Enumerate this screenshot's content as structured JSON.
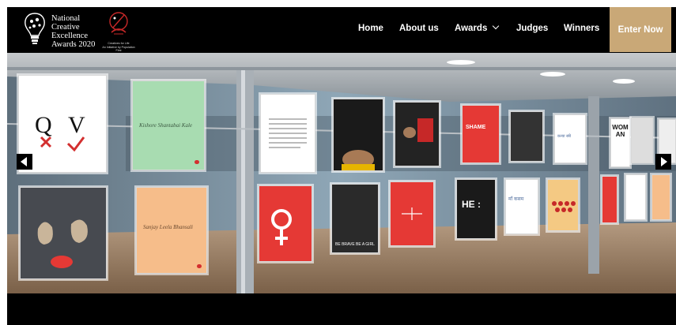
{
  "brand": {
    "logo_line1": "National",
    "logo_line2": "Creative",
    "logo_line3": "Excellence",
    "logo_line4": "Awards 2020",
    "partner_line1": "Creatives for Life",
    "partner_line2": "An Initiative by Population First"
  },
  "nav": {
    "items": [
      {
        "label": "Home"
      },
      {
        "label": "About us"
      },
      {
        "label": "Awards"
      },
      {
        "label": "Judges"
      },
      {
        "label": "Winners"
      }
    ],
    "cta_label": "Enter Now"
  },
  "hero": {
    "posters": {
      "p1_text": "Q V",
      "p2_name": "Kishore Shantabai Kale",
      "p3_name": "Sanjay Leela Bhansali",
      "p4_text": "HE :",
      "p5_text": "WOMAN",
      "p6_text": "BE BRAVE BE A GIRL",
      "p7_text": "कन्या स्त्री",
      "p8_text": "माँ कसम",
      "p9_text": "SHAME"
    }
  },
  "colors": {
    "accent": "#c9a877",
    "header_bg": "#000000"
  }
}
